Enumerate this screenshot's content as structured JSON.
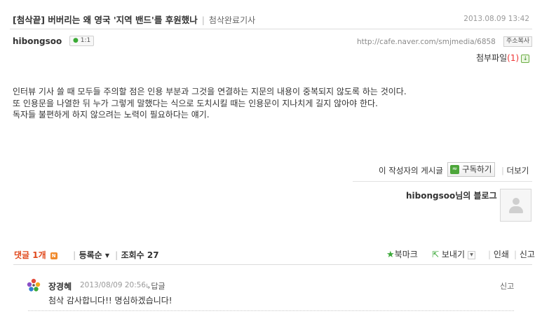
{
  "post": {
    "title": "[첨삭끝] 버버리는 왜 영국 '지역 밴드'를 후원했나",
    "category": "첨삭완료기사",
    "date": "2013.08.09 13:42",
    "author": "hibongsoo",
    "chat_label": "1:1",
    "url": "http://cafe.naver.com/smjmedia/6858",
    "copy_url_label": "주소복사",
    "attach_label": "첨부파일",
    "attach_count": "(1)",
    "body_lines": [
      "인터뷰 기사 쓸 때 모두들 주의할 점은 인용 부분과 그것을 연결하는 지문의 내용이 중복되지 않도록 하는 것이다.",
      "또 인용문을 나열한 뒤 누가 그렇게 말했다는 식으로 도치시킬 때는 인용문이 지나치게 길지 않아야 한다.",
      "독자들 불편하게 하지 않으려는 노력이 필요하다는 얘기."
    ]
  },
  "author_box": {
    "posts_label": "이 작성자의 게시글",
    "subscribe_label": "구독하기",
    "more_label": "더보기",
    "blog_title": "hibongsoo님의 블로그"
  },
  "toolbar": {
    "reply_count_label": "댓글 1개",
    "new_badge": "N",
    "order_label": "등록순",
    "views_label": "조회수 27",
    "bookmark_label": "북마크",
    "send_label": "보내기",
    "print_label": "인쇄",
    "report_label": "신고"
  },
  "comments": [
    {
      "author": "장경혜",
      "date": "2013/08/09 20:56",
      "reply_label": "답글",
      "report_label": "신고",
      "text": "첨삭 감사합니다!! 명심하겠습니다!"
    }
  ],
  "colors": {
    "accent_green": "#3aa838",
    "reply_count_red": "#e04a1e",
    "new_badge_orange": "#f08a2c"
  },
  "icons": {
    "chat": "speech-bubble-icon",
    "download": "download-arrow-icon",
    "rss": "rss-icon",
    "bookmark": "star-icon",
    "send": "share-arrow-icon",
    "comment_avatar": "flower-icon",
    "blog_avatar": "default-profile-icon"
  }
}
